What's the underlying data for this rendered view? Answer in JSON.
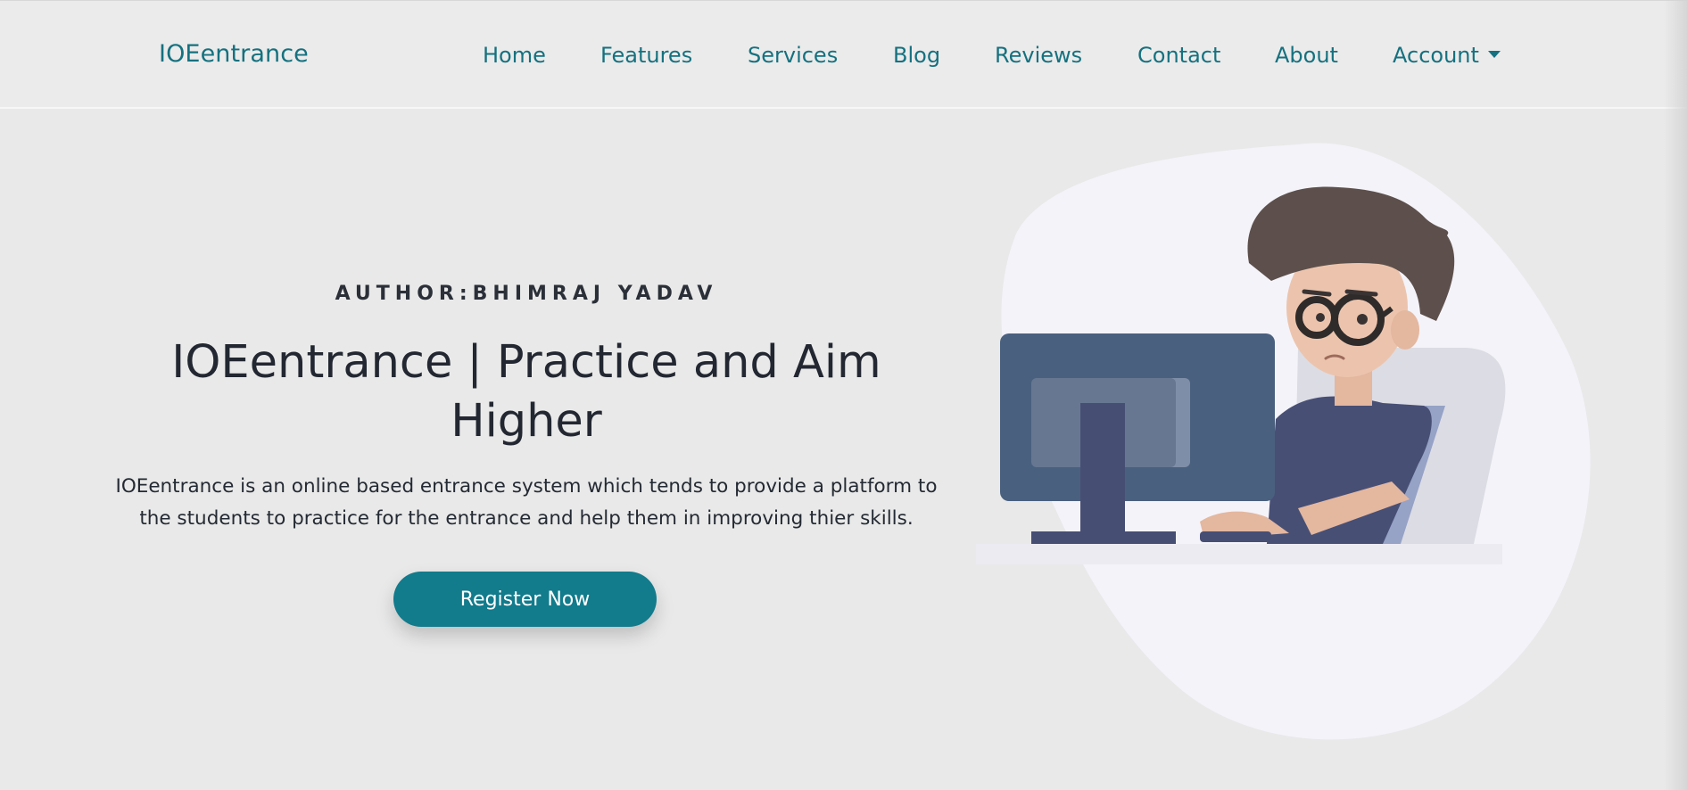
{
  "navbar": {
    "brand": "IOEentrance",
    "items": [
      {
        "label": "Home"
      },
      {
        "label": "Features"
      },
      {
        "label": "Services"
      },
      {
        "label": "Blog"
      },
      {
        "label": "Reviews"
      },
      {
        "label": "Contact"
      },
      {
        "label": "About"
      },
      {
        "label": "Account",
        "has_dropdown": true
      }
    ]
  },
  "hero": {
    "author": "AUTHOR:BHIMRAJ YADAV",
    "title_line1": "IOEentrance | Practice and Aim",
    "title_line2": "Higher",
    "description_line1": "IOEentrance is an online based entrance system which tends to provide a platform to",
    "description_line2": "the students to practice for the entrance and help them in improving thier skills.",
    "register_label": "Register Now"
  },
  "illustration": {
    "icon": "student-at-computer-illustration",
    "blob_color": "#f4f3f9",
    "monitor_color": "#4a607f",
    "hair_color": "#5d504c",
    "shirt_color": "#474f75"
  },
  "colors": {
    "accent": "#15717f",
    "button": "#127b8c",
    "background": "#e9e9e9",
    "heading": "#222731"
  }
}
